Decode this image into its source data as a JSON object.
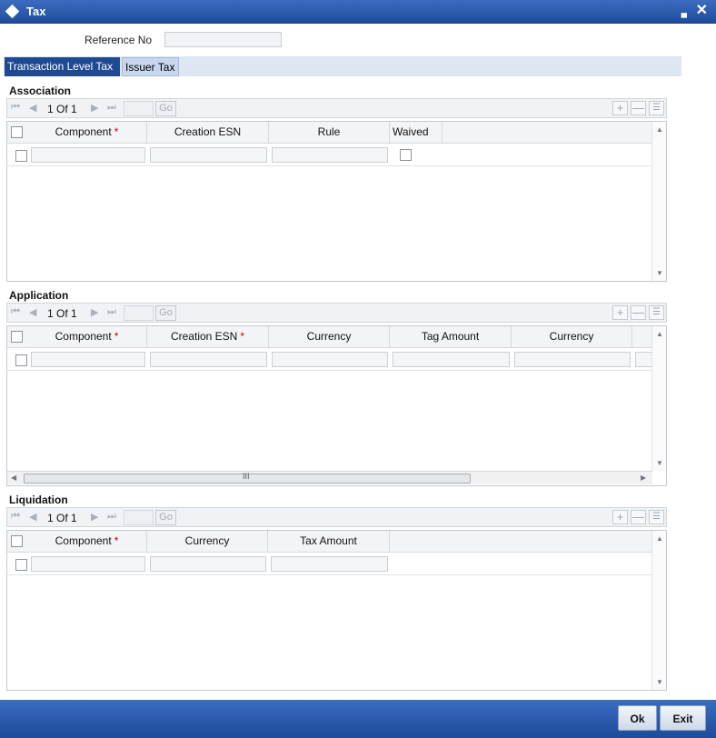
{
  "window": {
    "title": "Tax",
    "icon": "diamond-icon",
    "minimize": "▄",
    "close": "✕"
  },
  "reference": {
    "label": "Reference No",
    "value": ""
  },
  "tabs": [
    {
      "label": "Transaction Level Tax",
      "active": true
    },
    {
      "label": "Issuer Tax",
      "active": false
    }
  ],
  "navigation": {
    "page_text": "1 Of 1",
    "go": "Go",
    "first": "⏮",
    "prev": "◀",
    "next": "▶",
    "last": "⏭",
    "add": "+",
    "remove": "—",
    "view": "☰"
  },
  "association": {
    "title": "Association",
    "columns": [
      {
        "label": "Component",
        "required": true
      },
      {
        "label": "Creation ESN",
        "required": false
      },
      {
        "label": "Rule",
        "required": false
      },
      {
        "label": "Waived",
        "required": false
      }
    ],
    "rows": [
      {
        "component": "",
        "creation_esn": "",
        "rule": "",
        "waived": false
      }
    ]
  },
  "application": {
    "title": "Application",
    "columns": [
      {
        "label": "Component",
        "required": true
      },
      {
        "label": "Creation ESN",
        "required": true
      },
      {
        "label": "Currency",
        "required": false
      },
      {
        "label": "Tag Amount",
        "required": false
      },
      {
        "label": "Currency",
        "required": false
      }
    ],
    "rows": [
      {
        "component": "",
        "creation_esn": "",
        "currency": "",
        "tag_amount": "",
        "currency_2": ""
      }
    ]
  },
  "liquidation": {
    "title": "Liquidation",
    "columns": [
      {
        "label": "Component",
        "required": true
      },
      {
        "label": "Currency",
        "required": false
      },
      {
        "label": "Tax Amount",
        "required": false
      }
    ],
    "rows": [
      {
        "component": "",
        "currency": "",
        "tax_amount": ""
      }
    ]
  },
  "required_marker": "*",
  "scroll_grip": "III",
  "footer": {
    "ok_label": "Ok",
    "exit_label": "Exit"
  },
  "colors": {
    "titlebar": "#2a58a8",
    "tab_active": "#1f4a93",
    "required": "#d00000"
  }
}
